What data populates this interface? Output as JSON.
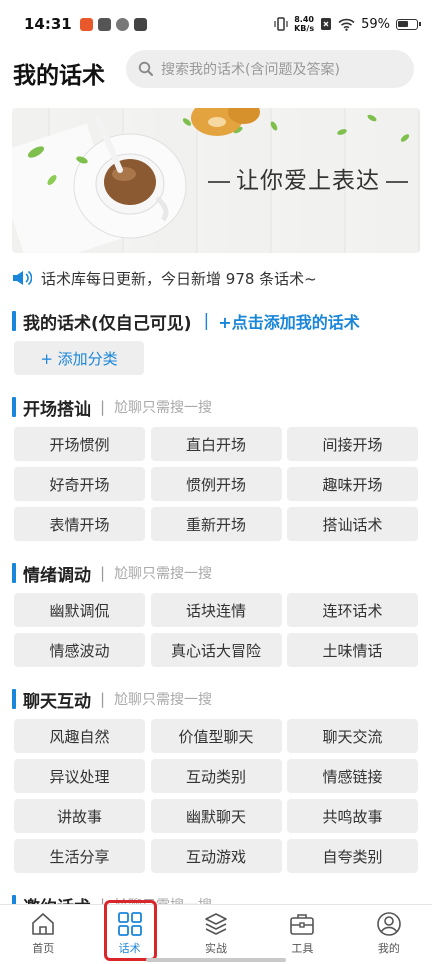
{
  "status_bar": {
    "time": "14:31",
    "net_speed_value": "8.40",
    "net_speed_unit": "KB/s",
    "battery": "59%"
  },
  "header": {
    "title": "我的话术",
    "search_placeholder": "搜索我的话术(含问题及答案)"
  },
  "banner": {
    "slogan": "让你爱上表达"
  },
  "notice": {
    "text": "话术库每日更新，今日新增 978 条话术~"
  },
  "my_section": {
    "title": "我的话术(仅自己可见)",
    "divider": "|",
    "add_link": "+点击添加我的话术",
    "add_category": "+ 添加分类"
  },
  "sections": [
    {
      "title": "开场搭讪",
      "subtitle": "尬聊只需搜一搜",
      "items": [
        "开场惯例",
        "直白开场",
        "间接开场",
        "好奇开场",
        "惯例开场",
        "趣味开场",
        "表情开场",
        "重新开场",
        "搭讪话术"
      ]
    },
    {
      "title": "情绪调动",
      "subtitle": "尬聊只需搜一搜",
      "items": [
        "幽默调侃",
        "话块连情",
        "连环话术",
        "情感波动",
        "真心话大冒险",
        "土味情话"
      ]
    },
    {
      "title": "聊天互动",
      "subtitle": "尬聊只需搜一搜",
      "items": [
        "风趣自然",
        "价值型聊天",
        "聊天交流",
        "异议处理",
        "互动类别",
        "情感链接",
        "讲故事",
        "幽默聊天",
        "共鸣故事",
        "生活分享",
        "互动游戏",
        "自夸类别"
      ]
    },
    {
      "title": "邀约话术",
      "subtitle": "尬聊只需搜一搜",
      "items": []
    }
  ],
  "tabs": [
    {
      "label": "首页",
      "icon": "home-icon"
    },
    {
      "label": "话术",
      "icon": "grid-icon",
      "active": true
    },
    {
      "label": "实战",
      "icon": "layers-icon"
    },
    {
      "label": "工具",
      "icon": "toolbox-icon"
    },
    {
      "label": "我的",
      "icon": "user-icon"
    }
  ],
  "colors": {
    "accent": "#1a86d9",
    "highlight_box": "#d9262b",
    "chip_bg": "#eeeeee"
  }
}
